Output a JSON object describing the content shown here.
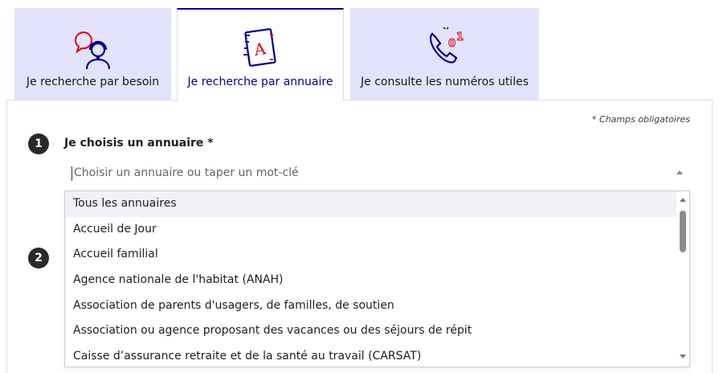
{
  "tabs": [
    {
      "label": "Je recherche par besoin",
      "icon": "support-agent-icon",
      "active": false
    },
    {
      "label": "Je recherche par annuaire",
      "icon": "address-book-icon",
      "active": true
    },
    {
      "label": "Je consulte les numéros utiles",
      "icon": "phone-numbers-icon",
      "active": false
    }
  ],
  "form": {
    "required_note": "* Champs obligatoires",
    "step1": {
      "number": "1",
      "label": "Je choisis un annuaire *"
    },
    "step2": {
      "number": "2"
    },
    "combo": {
      "placeholder": "Choisir un annuaire ou taper un mot-clé"
    }
  },
  "dropdown": {
    "options": [
      "Tous les annuaires",
      "Accueil de Jour",
      "Accueil familial",
      "Agence nationale de l'habitat (ANAH)",
      "Association de parents d'usagers, de familles, de soutien",
      "Association ou agence proposant des vacances ou des séjours de répit",
      "Caisse d’assurance retraite et de la santé au travail (CARSAT)"
    ],
    "highlighted_index": 0
  },
  "colors": {
    "tab_bg": "#e3e3fd",
    "accent_blue": "#000091",
    "accent_red": "#e1000f"
  }
}
